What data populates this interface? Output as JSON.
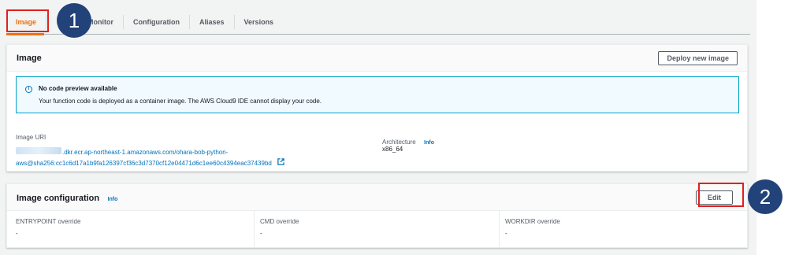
{
  "tabs": [
    {
      "label": "Image",
      "active": true
    },
    {
      "label": "Monitor",
      "active": false
    },
    {
      "label": "Configuration",
      "active": false
    },
    {
      "label": "Aliases",
      "active": false
    },
    {
      "label": "Versions",
      "active": false
    }
  ],
  "annotations": {
    "step1": "1",
    "step2": "2"
  },
  "image_panel": {
    "title": "Image",
    "deploy_button": "Deploy new image",
    "alert": {
      "title": "No code preview available",
      "body": "Your function code is deployed as a container image. The AWS Cloud9 IDE cannot display your code."
    },
    "image_uri_label": "Image URI",
    "image_uri_line1": ".dkr.ecr.ap-northeast-1.amazonaws.com/ohara-bob-python-",
    "image_uri_line2": "aws@sha256:cc1c6d17a1b9fa126397cf36c3d7370cf12e04471d6c1ee60c4394eac37439bd",
    "architecture_label": "Architecture",
    "architecture_info": "Info",
    "architecture_value": "x86_64"
  },
  "config_panel": {
    "title": "Image configuration",
    "info": "Info",
    "edit_button": "Edit",
    "fields": [
      {
        "label": "ENTRYPOINT override",
        "value": "-"
      },
      {
        "label": "CMD override",
        "value": "-"
      },
      {
        "label": "WORKDIR override",
        "value": "-"
      }
    ]
  },
  "colors": {
    "accent": "#ec7211",
    "link": "#0073bb",
    "annotation": "#e02020",
    "badge": "#22427a"
  }
}
